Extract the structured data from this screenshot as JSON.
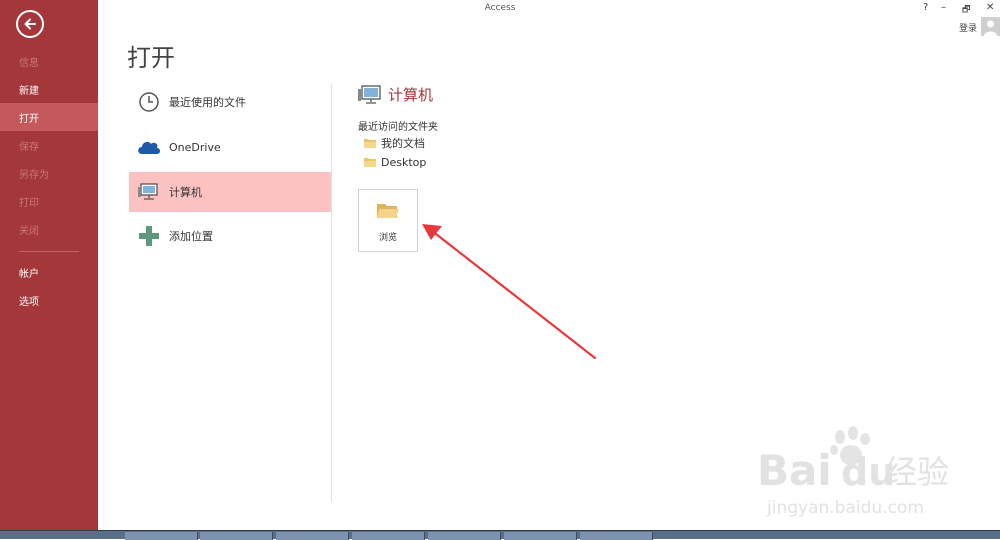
{
  "app": {
    "title": "Access",
    "sign_in": "登录"
  },
  "window_controls": {
    "help": "?",
    "minimize": "–",
    "restore": "🗗",
    "close": "✕"
  },
  "sidebar": {
    "items": [
      {
        "label": "信息",
        "state": "disabled"
      },
      {
        "label": "新建",
        "state": "normal"
      },
      {
        "label": "打开",
        "state": "active"
      },
      {
        "label": "保存",
        "state": "disabled"
      },
      {
        "label": "另存为",
        "state": "disabled"
      },
      {
        "label": "打印",
        "state": "disabled"
      },
      {
        "label": "关闭",
        "state": "disabled"
      },
      {
        "label": "帐户",
        "state": "normal"
      },
      {
        "label": "选项",
        "state": "normal"
      }
    ]
  },
  "page": {
    "title": "打开"
  },
  "places": [
    {
      "label": "最近使用的文件",
      "icon": "clock-icon"
    },
    {
      "label": "OneDrive",
      "icon": "cloud-icon"
    },
    {
      "label": "计算机",
      "icon": "computer-icon",
      "selected": true
    },
    {
      "label": "添加位置",
      "icon": "plus-icon"
    }
  ],
  "computer_panel": {
    "title": "计算机",
    "recent_label": "最近访问的文件夹",
    "folders": [
      {
        "name": "我的文档"
      },
      {
        "name": "Desktop"
      }
    ],
    "browse_label": "浏览"
  },
  "watermark": {
    "brand": "Bai",
    "brand2": "du",
    "brand_cn": "经验",
    "url": "jingyan.baidu.com"
  },
  "colors": {
    "accent": "#a4373a",
    "selected": "#fcc2c2",
    "annotation_arrow": "#e8383d"
  }
}
